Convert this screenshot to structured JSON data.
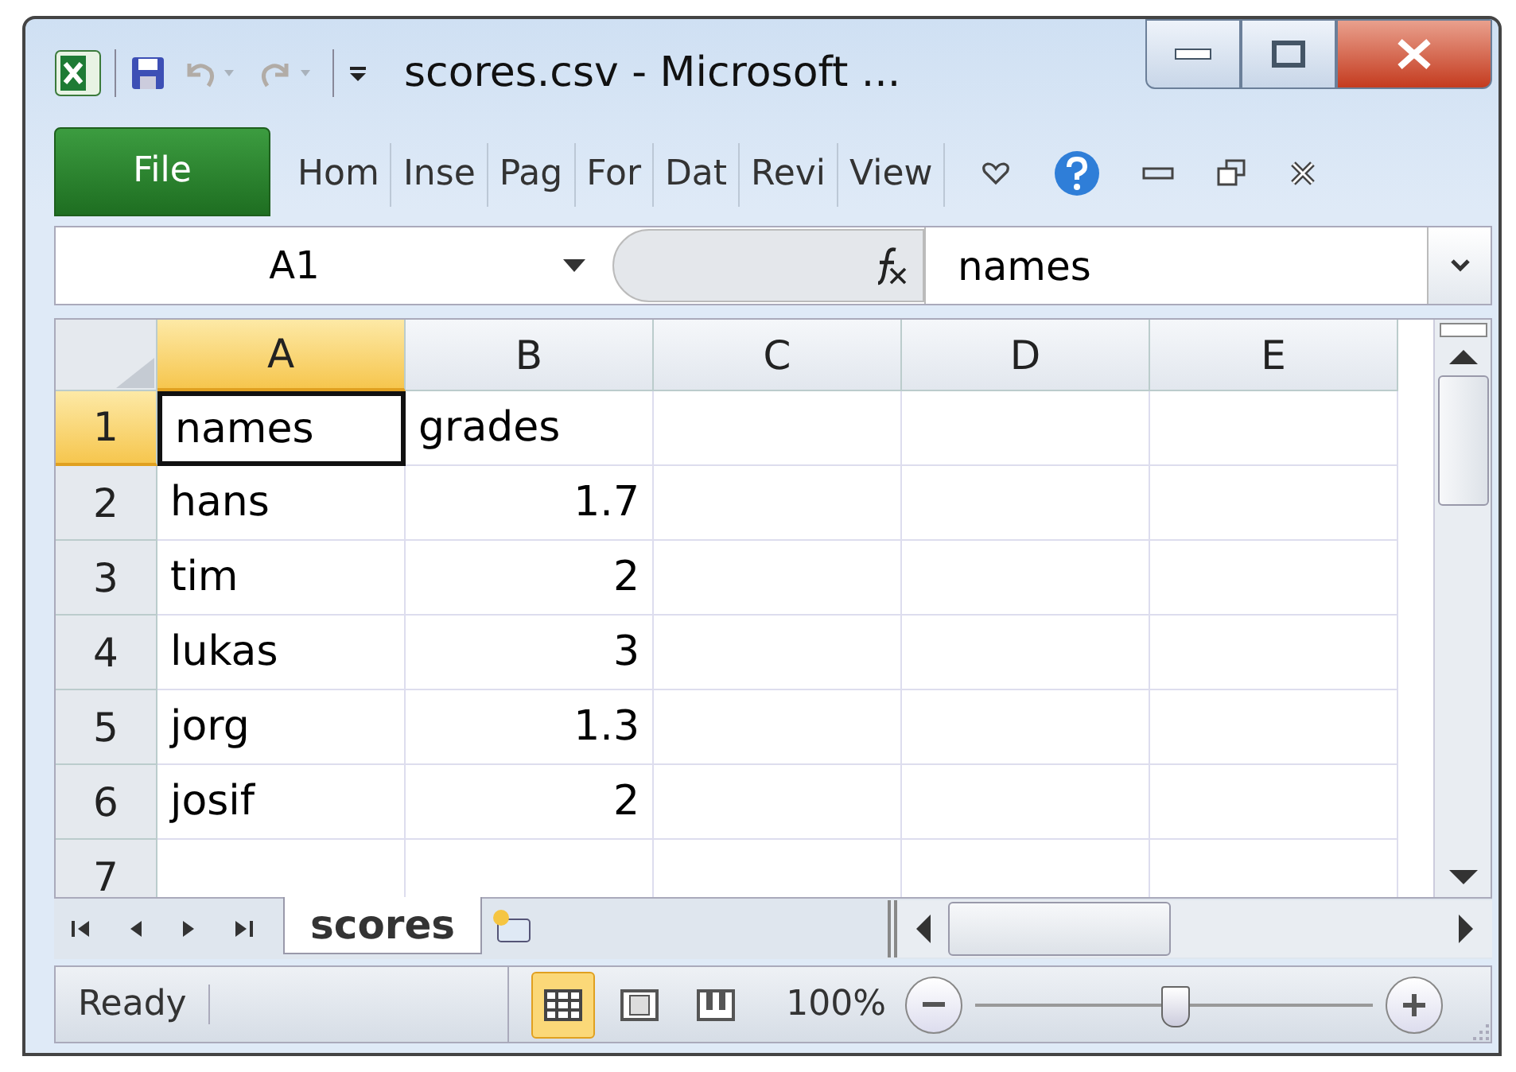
{
  "window": {
    "title": "scores.csv  -  Microsoft ..."
  },
  "quick_access": [
    {
      "kind": "save",
      "disabled": false
    },
    {
      "kind": "undo",
      "disabled": true
    },
    {
      "kind": "redo",
      "disabled": true
    }
  ],
  "ribbon_tabs": [
    {
      "label": "File",
      "kind": "file",
      "selected": false
    },
    {
      "label": "Hom",
      "kind": "tab",
      "selected": false
    },
    {
      "label": "Inse",
      "kind": "tab",
      "selected": false
    },
    {
      "label": "Pag",
      "kind": "tab",
      "selected": false
    },
    {
      "label": "For",
      "kind": "tab",
      "selected": false
    },
    {
      "label": "Dat",
      "kind": "tab",
      "selected": false
    },
    {
      "label": "Revi",
      "kind": "tab",
      "selected": false
    },
    {
      "label": "View",
      "kind": "tab",
      "selected": false
    }
  ],
  "name_box": {
    "value": "A1"
  },
  "formula_bar": {
    "value": "names"
  },
  "columns": [
    {
      "label": "A",
      "selected": true
    },
    {
      "label": "B",
      "selected": false
    },
    {
      "label": "C",
      "selected": false
    },
    {
      "label": "D",
      "selected": false
    },
    {
      "label": "E",
      "selected": false
    }
  ],
  "rows": [
    {
      "label": "1",
      "selected": true,
      "cells": [
        {
          "text": "names",
          "kind": "text",
          "selected": true
        },
        {
          "text": "grades",
          "kind": "text",
          "selected": false
        }
      ]
    },
    {
      "label": "2",
      "selected": false,
      "cells": [
        {
          "text": "hans",
          "kind": "text",
          "selected": false
        },
        {
          "text": "1.7",
          "kind": "number",
          "selected": false
        }
      ]
    },
    {
      "label": "3",
      "selected": false,
      "cells": [
        {
          "text": "tim",
          "kind": "text",
          "selected": false
        },
        {
          "text": "2",
          "kind": "number",
          "selected": false
        }
      ]
    },
    {
      "label": "4",
      "selected": false,
      "cells": [
        {
          "text": "lukas",
          "kind": "text",
          "selected": false
        },
        {
          "text": "3",
          "kind": "number",
          "selected": false
        }
      ]
    },
    {
      "label": "5",
      "selected": false,
      "cells": [
        {
          "text": "jorg",
          "kind": "text",
          "selected": false
        },
        {
          "text": "1.3",
          "kind": "number",
          "selected": false
        }
      ]
    },
    {
      "label": "6",
      "selected": false,
      "cells": [
        {
          "text": "josif",
          "kind": "text",
          "selected": false
        },
        {
          "text": "2",
          "kind": "number",
          "selected": false
        }
      ]
    },
    {
      "label": "7",
      "selected": false
    }
  ],
  "sheet_tabs": [
    {
      "label": "scores",
      "selected": true
    }
  ],
  "status_bar": {
    "text": "Ready",
    "views": [
      {
        "kind": "normal",
        "selected": true
      },
      {
        "kind": "layout",
        "selected": false
      },
      {
        "kind": "pagebreak",
        "selected": false
      }
    ],
    "zoom": "100%",
    "zoom_slider": {
      "level": 0.5
    }
  }
}
